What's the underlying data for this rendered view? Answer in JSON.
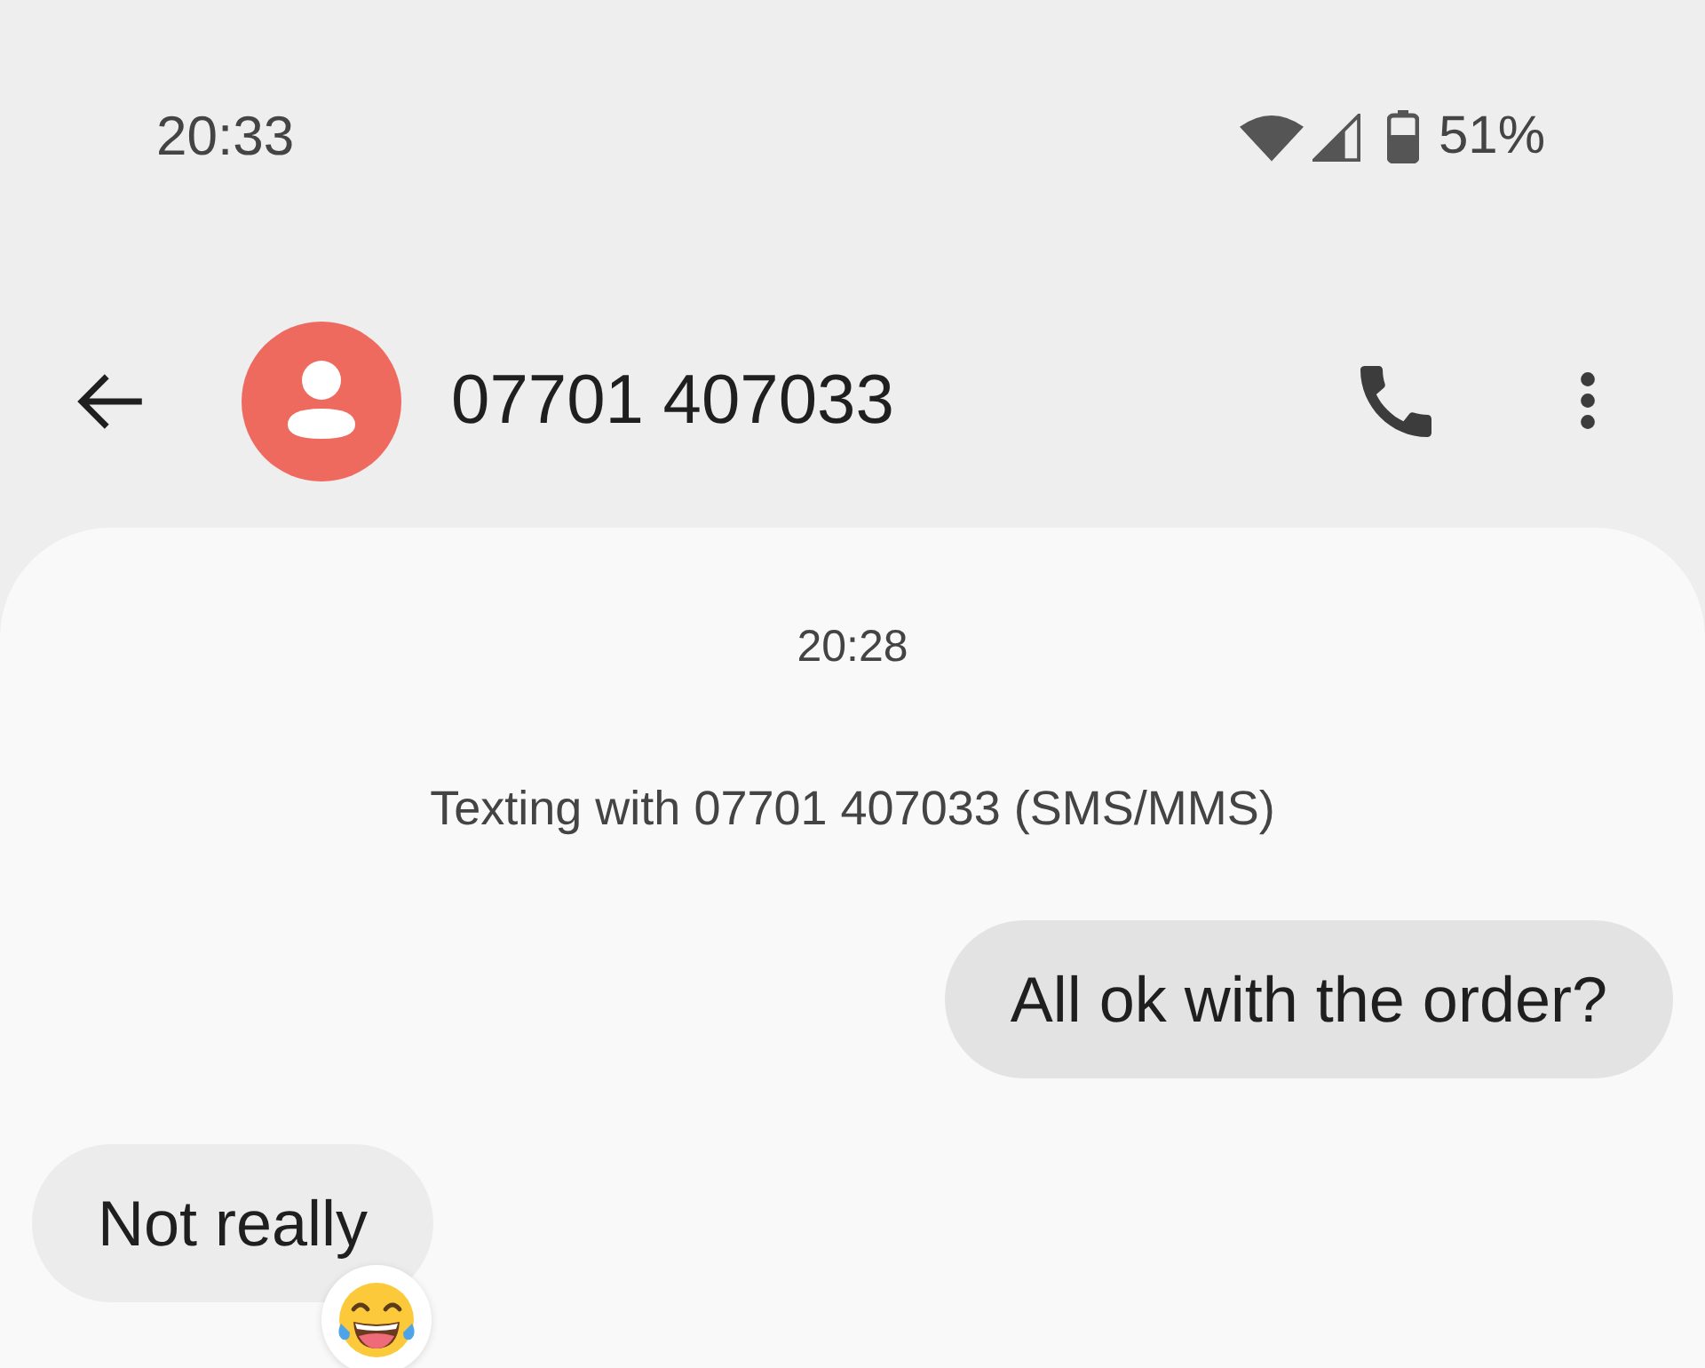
{
  "status_bar": {
    "time": "20:33",
    "battery": "51%"
  },
  "header": {
    "contact": "07701 407033"
  },
  "conversation": {
    "timestamp": "20:28",
    "info": "Texting with 07701 407033 (SMS/MMS)",
    "messages": [
      {
        "kind": "sent",
        "text": "All ok with the order?",
        "reacted": false
      },
      {
        "kind": "received",
        "text": "Not really",
        "reacted": true
      }
    ]
  }
}
